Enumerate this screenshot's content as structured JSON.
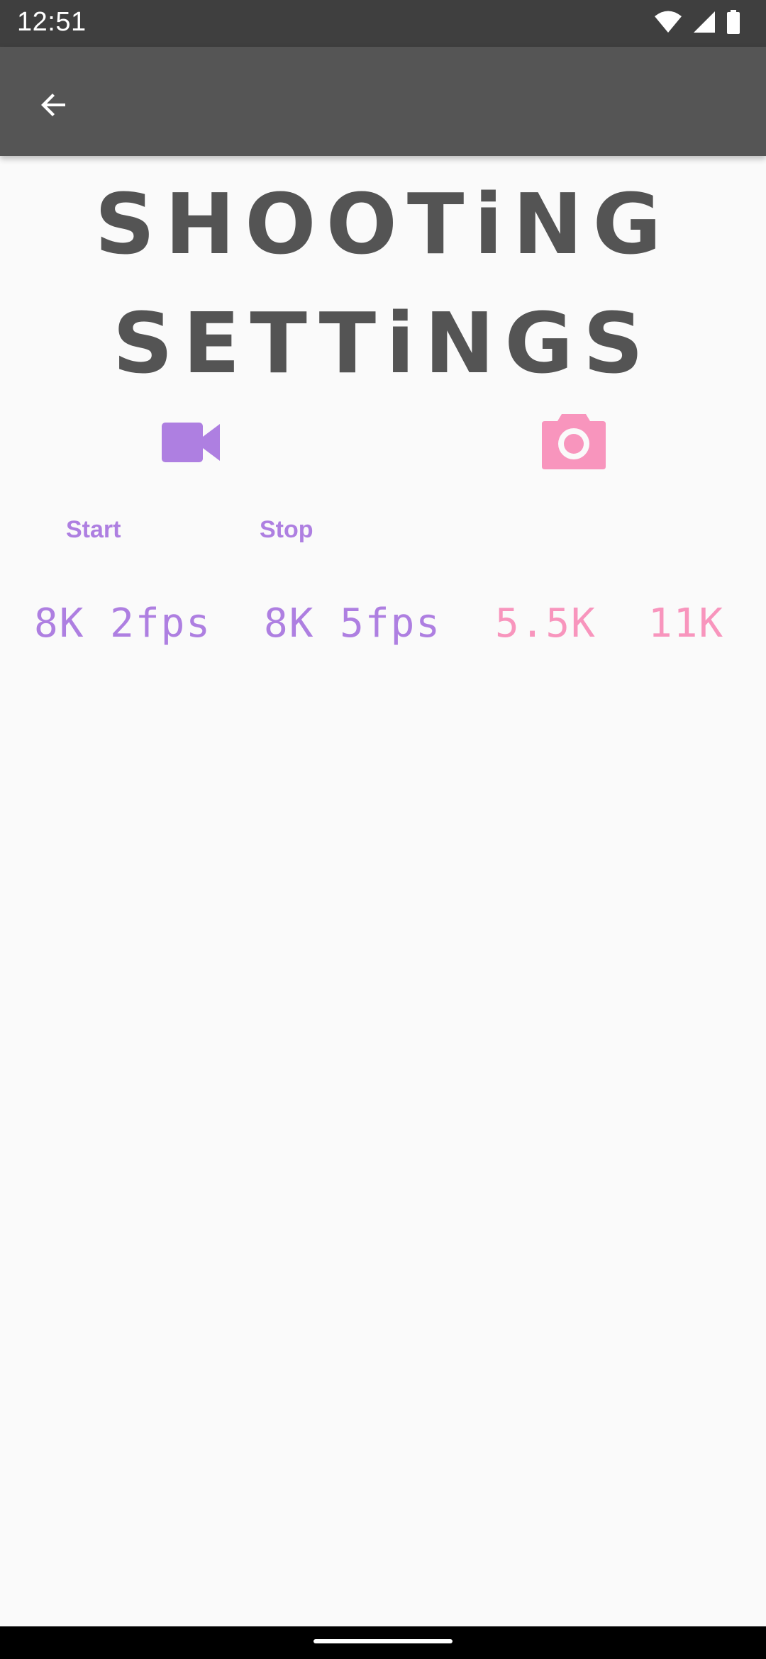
{
  "status_bar": {
    "time": "12:51",
    "icons": [
      "wifi-icon",
      "cellular-signal-icon",
      "battery-icon"
    ]
  },
  "app_bar": {
    "back_icon": "arrow-left-icon"
  },
  "title": {
    "line1": "SHOOTiNG",
    "line2": "SETTiNGS"
  },
  "modes": {
    "video_icon": "videocam-icon",
    "camera_icon": "camera-icon"
  },
  "controls": {
    "start_label": "Start",
    "stop_label": "Stop"
  },
  "presets": [
    {
      "label": "8K 2fps"
    },
    {
      "label": "8K 5fps"
    },
    {
      "label": "5.5K"
    },
    {
      "label": "11K"
    }
  ],
  "colors": {
    "status_bar": "#3f3f3f",
    "app_bar": "#555555",
    "background": "#fafafa",
    "title": "#545454",
    "video_accent": "#ae7fe1",
    "photo_accent": "#f895bd"
  }
}
